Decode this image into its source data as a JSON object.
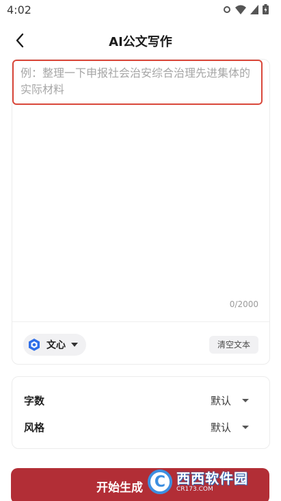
{
  "status_bar": {
    "time": "4:02",
    "icons": [
      "settings-dot-icon",
      "wifi-icon",
      "signal-icon",
      "battery-icon"
    ]
  },
  "header": {
    "title": "AI公文写作",
    "back_icon": "chevron-left-icon"
  },
  "editor": {
    "placeholder": "例：整理一下申报社会治安综合治理先进集体的实际材料",
    "char_count": "0/2000",
    "model": {
      "label": "文心",
      "icon": "wenxin-logo-icon",
      "dropdown_icon": "caret-down-icon"
    },
    "clear_label": "清空文本",
    "accent_color": "#d9473a"
  },
  "options": [
    {
      "label": "字数",
      "value": "默认"
    },
    {
      "label": "风格",
      "value": "默认"
    }
  ],
  "generate": {
    "label": "开始生成",
    "color": "#b22e36"
  },
  "watermark": {
    "logo_letter": "C",
    "title": "西西软件园",
    "subtitle": "CR173.COM"
  }
}
